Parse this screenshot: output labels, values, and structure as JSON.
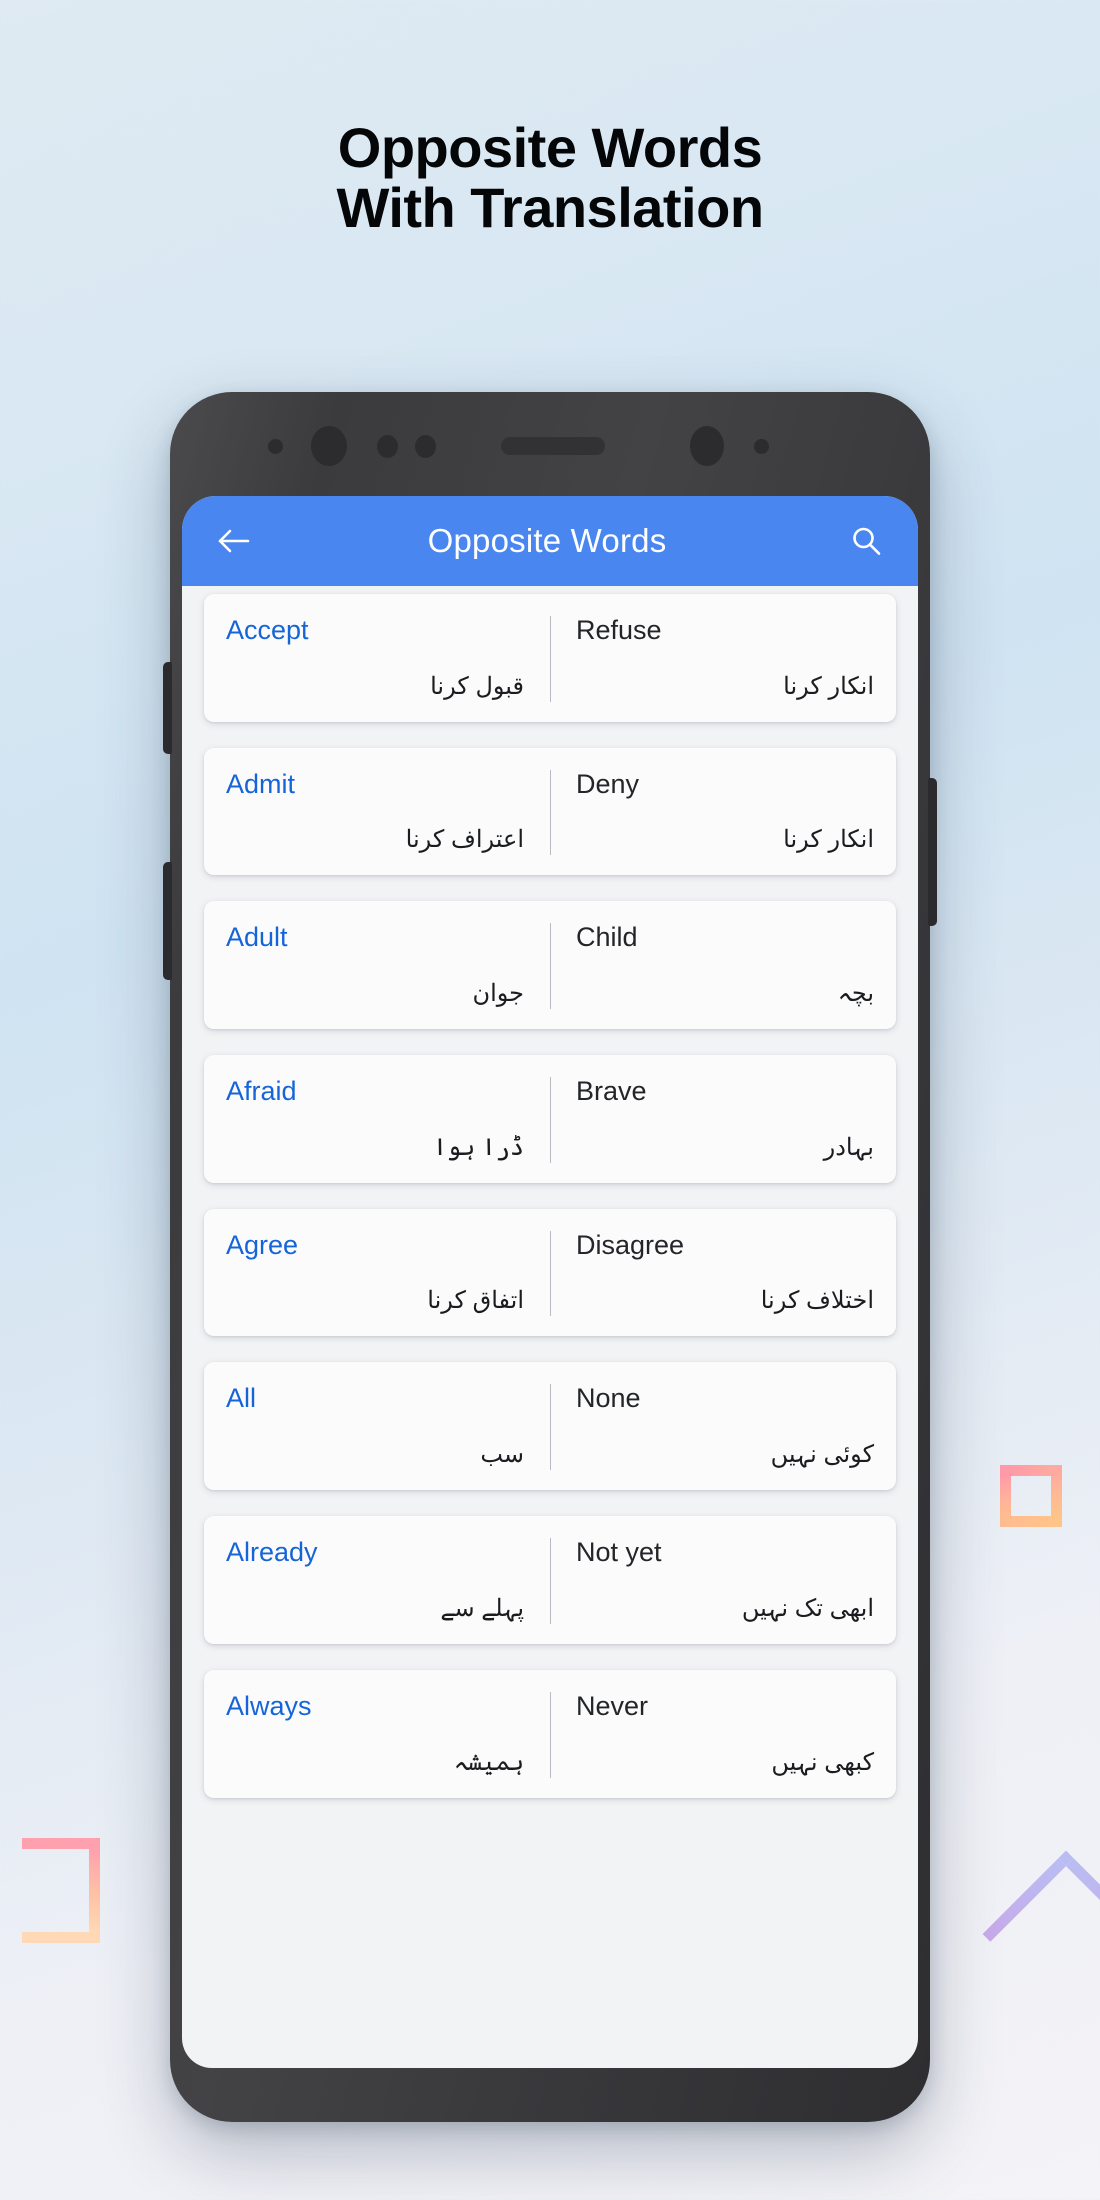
{
  "poster": {
    "title_line1": "Opposite Words",
    "title_line2": "With Translation"
  },
  "appbar": {
    "back_icon": "arrow-left-icon",
    "title": "Opposite Words",
    "search_icon": "search-icon",
    "background_color": "#4a86f0",
    "title_color": "#ffffff"
  },
  "theme": {
    "accent_blue": "#4a86f0",
    "word_source_color": "#1565d8",
    "word_dest_color": "#232528",
    "card_background": "#fbfbfc",
    "page_background": "#dfeaf2"
  },
  "list": {
    "items": [
      {
        "source_en": "Accept",
        "source_ur": "قبول کرنا",
        "dest_en": "Refuse",
        "dest_ur": "انکار کرنا"
      },
      {
        "source_en": "Admit",
        "source_ur": "اعتراف کرنا",
        "dest_en": "Deny",
        "dest_ur": "انکار کرنا"
      },
      {
        "source_en": "Adult",
        "source_ur": "جوان",
        "dest_en": "Child",
        "dest_ur": "بچہ"
      },
      {
        "source_en": "Afraid",
        "source_ur": "ڈرا ہوا",
        "dest_en": "Brave",
        "dest_ur": "بہادر"
      },
      {
        "source_en": "Agree",
        "source_ur": "اتفاق کرنا",
        "dest_en": "Disagree",
        "dest_ur": "اختلاف کرنا"
      },
      {
        "source_en": "All",
        "source_ur": "سب",
        "dest_en": "None",
        "dest_ur": "کوئی نہیں"
      },
      {
        "source_en": "Already",
        "source_ur": "پہلے سے",
        "dest_en": "Not yet",
        "dest_ur": "ابھی تک نہیں"
      },
      {
        "source_en": "Always",
        "source_ur": "ہمیشہ",
        "dest_en": "Never",
        "dest_ur": "کبھی نہیں"
      }
    ]
  },
  "decorations": [
    {
      "name": "square-outline",
      "colors": [
        "#ff9aa8",
        "#ffc488"
      ]
    },
    {
      "name": "bracket-outline",
      "colors": [
        "#ffa0ae",
        "#ffd9b6"
      ]
    },
    {
      "name": "diamond-outline",
      "colors": [
        "#b9bdf2",
        "#d4a3e4"
      ]
    }
  ]
}
